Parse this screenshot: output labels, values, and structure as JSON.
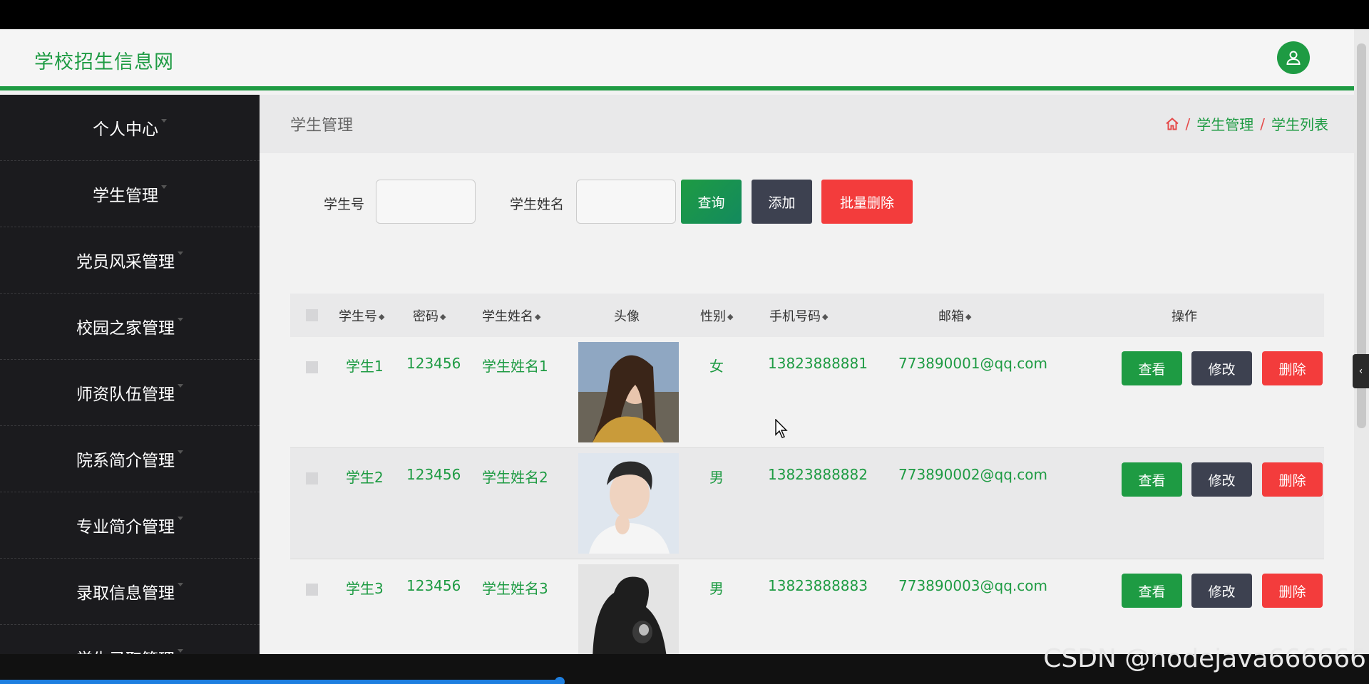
{
  "header": {
    "brand": "学校招生信息网"
  },
  "sidebar": {
    "items": [
      {
        "label": "个人中心"
      },
      {
        "label": "学生管理"
      },
      {
        "label": "党员风采管理"
      },
      {
        "label": "校园之家管理"
      },
      {
        "label": "师资队伍管理"
      },
      {
        "label": "院系简介管理"
      },
      {
        "label": "专业简介管理"
      },
      {
        "label": "录取信息管理"
      },
      {
        "label": "学生录取管理"
      }
    ]
  },
  "page": {
    "title": "学生管理",
    "breadcrumb": [
      "学生管理",
      "学生列表"
    ]
  },
  "search": {
    "student_no_label": "学生号",
    "student_no_value": "",
    "student_name_label": "学生姓名",
    "student_name_value": "",
    "query_label": "查询",
    "add_label": "添加",
    "batch_delete_label": "批量删除"
  },
  "table": {
    "columns": [
      "学生号",
      "密码",
      "学生姓名",
      "头像",
      "性别",
      "手机号码",
      "邮箱",
      "操作"
    ],
    "rows": [
      {
        "no": "学生1",
        "password": "123456",
        "name": "学生姓名1",
        "gender": "女",
        "phone": "13823888881",
        "email": "773890001@qq.com"
      },
      {
        "no": "学生2",
        "password": "123456",
        "name": "学生姓名2",
        "gender": "男",
        "phone": "13823888882",
        "email": "773890002@qq.com"
      },
      {
        "no": "学生3",
        "password": "123456",
        "name": "学生姓名3",
        "gender": "男",
        "phone": "13823888883",
        "email": "773890003@qq.com"
      }
    ],
    "actions": {
      "view": "查看",
      "edit": "修改",
      "delete": "删除"
    }
  },
  "watermark": "CSDN @nodejava666666",
  "colors": {
    "accent": "#1e9b43",
    "danger": "#f33c3c",
    "dark": "#3d4150",
    "sidebar": "#1b1b1e"
  }
}
